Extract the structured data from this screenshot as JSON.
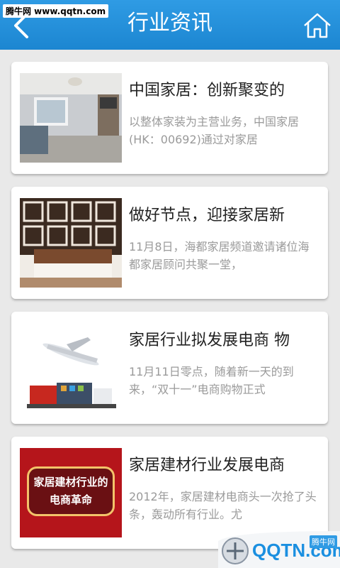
{
  "watermark": "腾牛网 www.qqtn.com",
  "header": {
    "title": "行业资讯"
  },
  "articles": [
    {
      "title": "中国家居：创新聚变的",
      "summary": "以整体家装为主营业务，中国家居(HK：00692)通过对家居"
    },
    {
      "title": "做好节点，迎接家居新",
      "summary": "11月8日，海都家居频道邀请诸位海都家居顾问共聚一堂，"
    },
    {
      "title": "家居行业拟发展电商 物",
      "summary": "11月11日零点，随着新一天的到来，“双十一”电商购物正式"
    },
    {
      "title": "家居建材行业发展电商",
      "summary": "2012年，家居建材电商头一次抢了头条，轰动所有行业。尤",
      "image_text_line1": "家居建材行业的",
      "image_text_line2": "电商革命"
    }
  ],
  "badge": {
    "brand": "QQTN.com",
    "tag": "腾牛网"
  },
  "colors": {
    "header": "#2287d6",
    "title_text": "#222222",
    "summary_text": "#9a9a9a"
  },
  "icons": {
    "back": "chevron-left-icon",
    "home": "home-icon"
  }
}
